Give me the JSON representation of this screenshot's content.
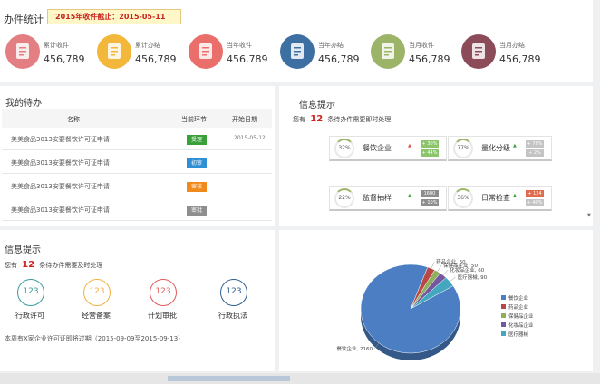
{
  "header": {
    "title": "办件统计",
    "banner": "2015年收件截止：2015-05-11"
  },
  "stats": [
    {
      "label": "累计收件",
      "value": "456,789",
      "color": "#e37f83",
      "icon": "inbox-icon"
    },
    {
      "label": "累计办结",
      "value": "456,789",
      "color": "#f2b73b",
      "icon": "stack-icon"
    },
    {
      "label": "当年收件",
      "value": "456,789",
      "color": "#ea6e6a",
      "icon": "cabinet-icon"
    },
    {
      "label": "当年办结",
      "value": "456,789",
      "color": "#3d6fa3",
      "icon": "monitor-check-icon"
    },
    {
      "label": "当月收件",
      "value": "456,789",
      "color": "#9cb468",
      "icon": "calendar-icon"
    },
    {
      "label": "当月办结",
      "value": "456,789",
      "color": "#8b4b58",
      "icon": "document-icon"
    }
  ],
  "todo": {
    "title": "我的待办",
    "columns": [
      "名称",
      "当前环节",
      "开始日期"
    ],
    "rows": [
      {
        "name": "美美食品3013安要餐饮许可证申请",
        "stage": "受理",
        "stage_color": "#3aa13a",
        "date": "2015-05-12"
      },
      {
        "name": "美美食品3013安要餐饮许可证申请",
        "stage": "初审",
        "stage_color": "#2e8fd5",
        "date": ""
      },
      {
        "name": "美美食品3013安要餐饮许可证申请",
        "stage": "审核",
        "stage_color": "#f08a1c",
        "date": ""
      },
      {
        "name": "美美食品3013安要餐饮许可证申请",
        "stage": "审批",
        "stage_color": "#8e8e8e",
        "date": ""
      }
    ]
  },
  "info_right": {
    "title": "信息提示",
    "text_before": "您有",
    "count": "12",
    "text_after": "条待办件需要即时处理",
    "cards": [
      {
        "pct": "32%",
        "name": "餐饮企业",
        "arrow": "▲",
        "arrow_color": "#e34c4c",
        "chip1": "+ 30%",
        "chip1_color": "#8bc46a",
        "chip2": "+ 44%",
        "chip2_color": "#8bc46a"
      },
      {
        "pct": "77%",
        "name": "量化分级",
        "arrow": "▲",
        "arrow_color": "#3aa13a",
        "chip1": "+ 78%",
        "chip1_color": "#c4c4c4",
        "chip2": "+ 2%",
        "chip2_color": "#c4c4c4"
      },
      {
        "pct": "22%",
        "name": "监督抽样",
        "arrow": "▲",
        "arrow_color": "#3aa13a",
        "chip1": "1600",
        "chip1_color": "#8e8e8e",
        "chip2": "+ 10%",
        "chip2_color": "#8e8e8e"
      },
      {
        "pct": "36%",
        "name": "日常检查",
        "arrow": "▲",
        "arrow_color": "#3aa13a",
        "chip1": "+ 124",
        "chip1_color": "#e06b4c",
        "chip2": "+ 40%",
        "chip2_color": "#c4c4c4"
      }
    ]
  },
  "info_left": {
    "title": "信息提示",
    "text_before": "您有",
    "count": "12",
    "text_after": "条待办件需要及时处理",
    "rings": [
      {
        "value": "123",
        "label": "行政许可",
        "color": "#3a9b9b"
      },
      {
        "value": "123",
        "label": "经营备案",
        "color": "#f2b040"
      },
      {
        "value": "123",
        "label": "计划审批",
        "color": "#e05858"
      },
      {
        "value": "123",
        "label": "行政执法",
        "color": "#2e5f8e"
      }
    ],
    "footer": "本周有X家企业许可证即将过期（2015-09-09至2015-09-13）"
  },
  "chart_data": {
    "type": "pie",
    "title": "",
    "slices": [
      {
        "label": "餐饮企业",
        "value": 2160,
        "color": "#4b7ec2"
      },
      {
        "label": "药品企业",
        "value": 60,
        "color": "#b84848"
      },
      {
        "label": "保健品企业",
        "value": 50,
        "color": "#8fb05a"
      },
      {
        "label": "化妆品企业",
        "value": 60,
        "color": "#7458a0"
      },
      {
        "label": "医疗器械",
        "value": 90,
        "color": "#44a7c0"
      }
    ],
    "data_labels": [
      "餐饮企业, 2160",
      "药品企业, 60",
      "保健品企业, 50",
      "化妆品企业, 60",
      "医疗器械, 90"
    ],
    "legend_position": "right"
  }
}
